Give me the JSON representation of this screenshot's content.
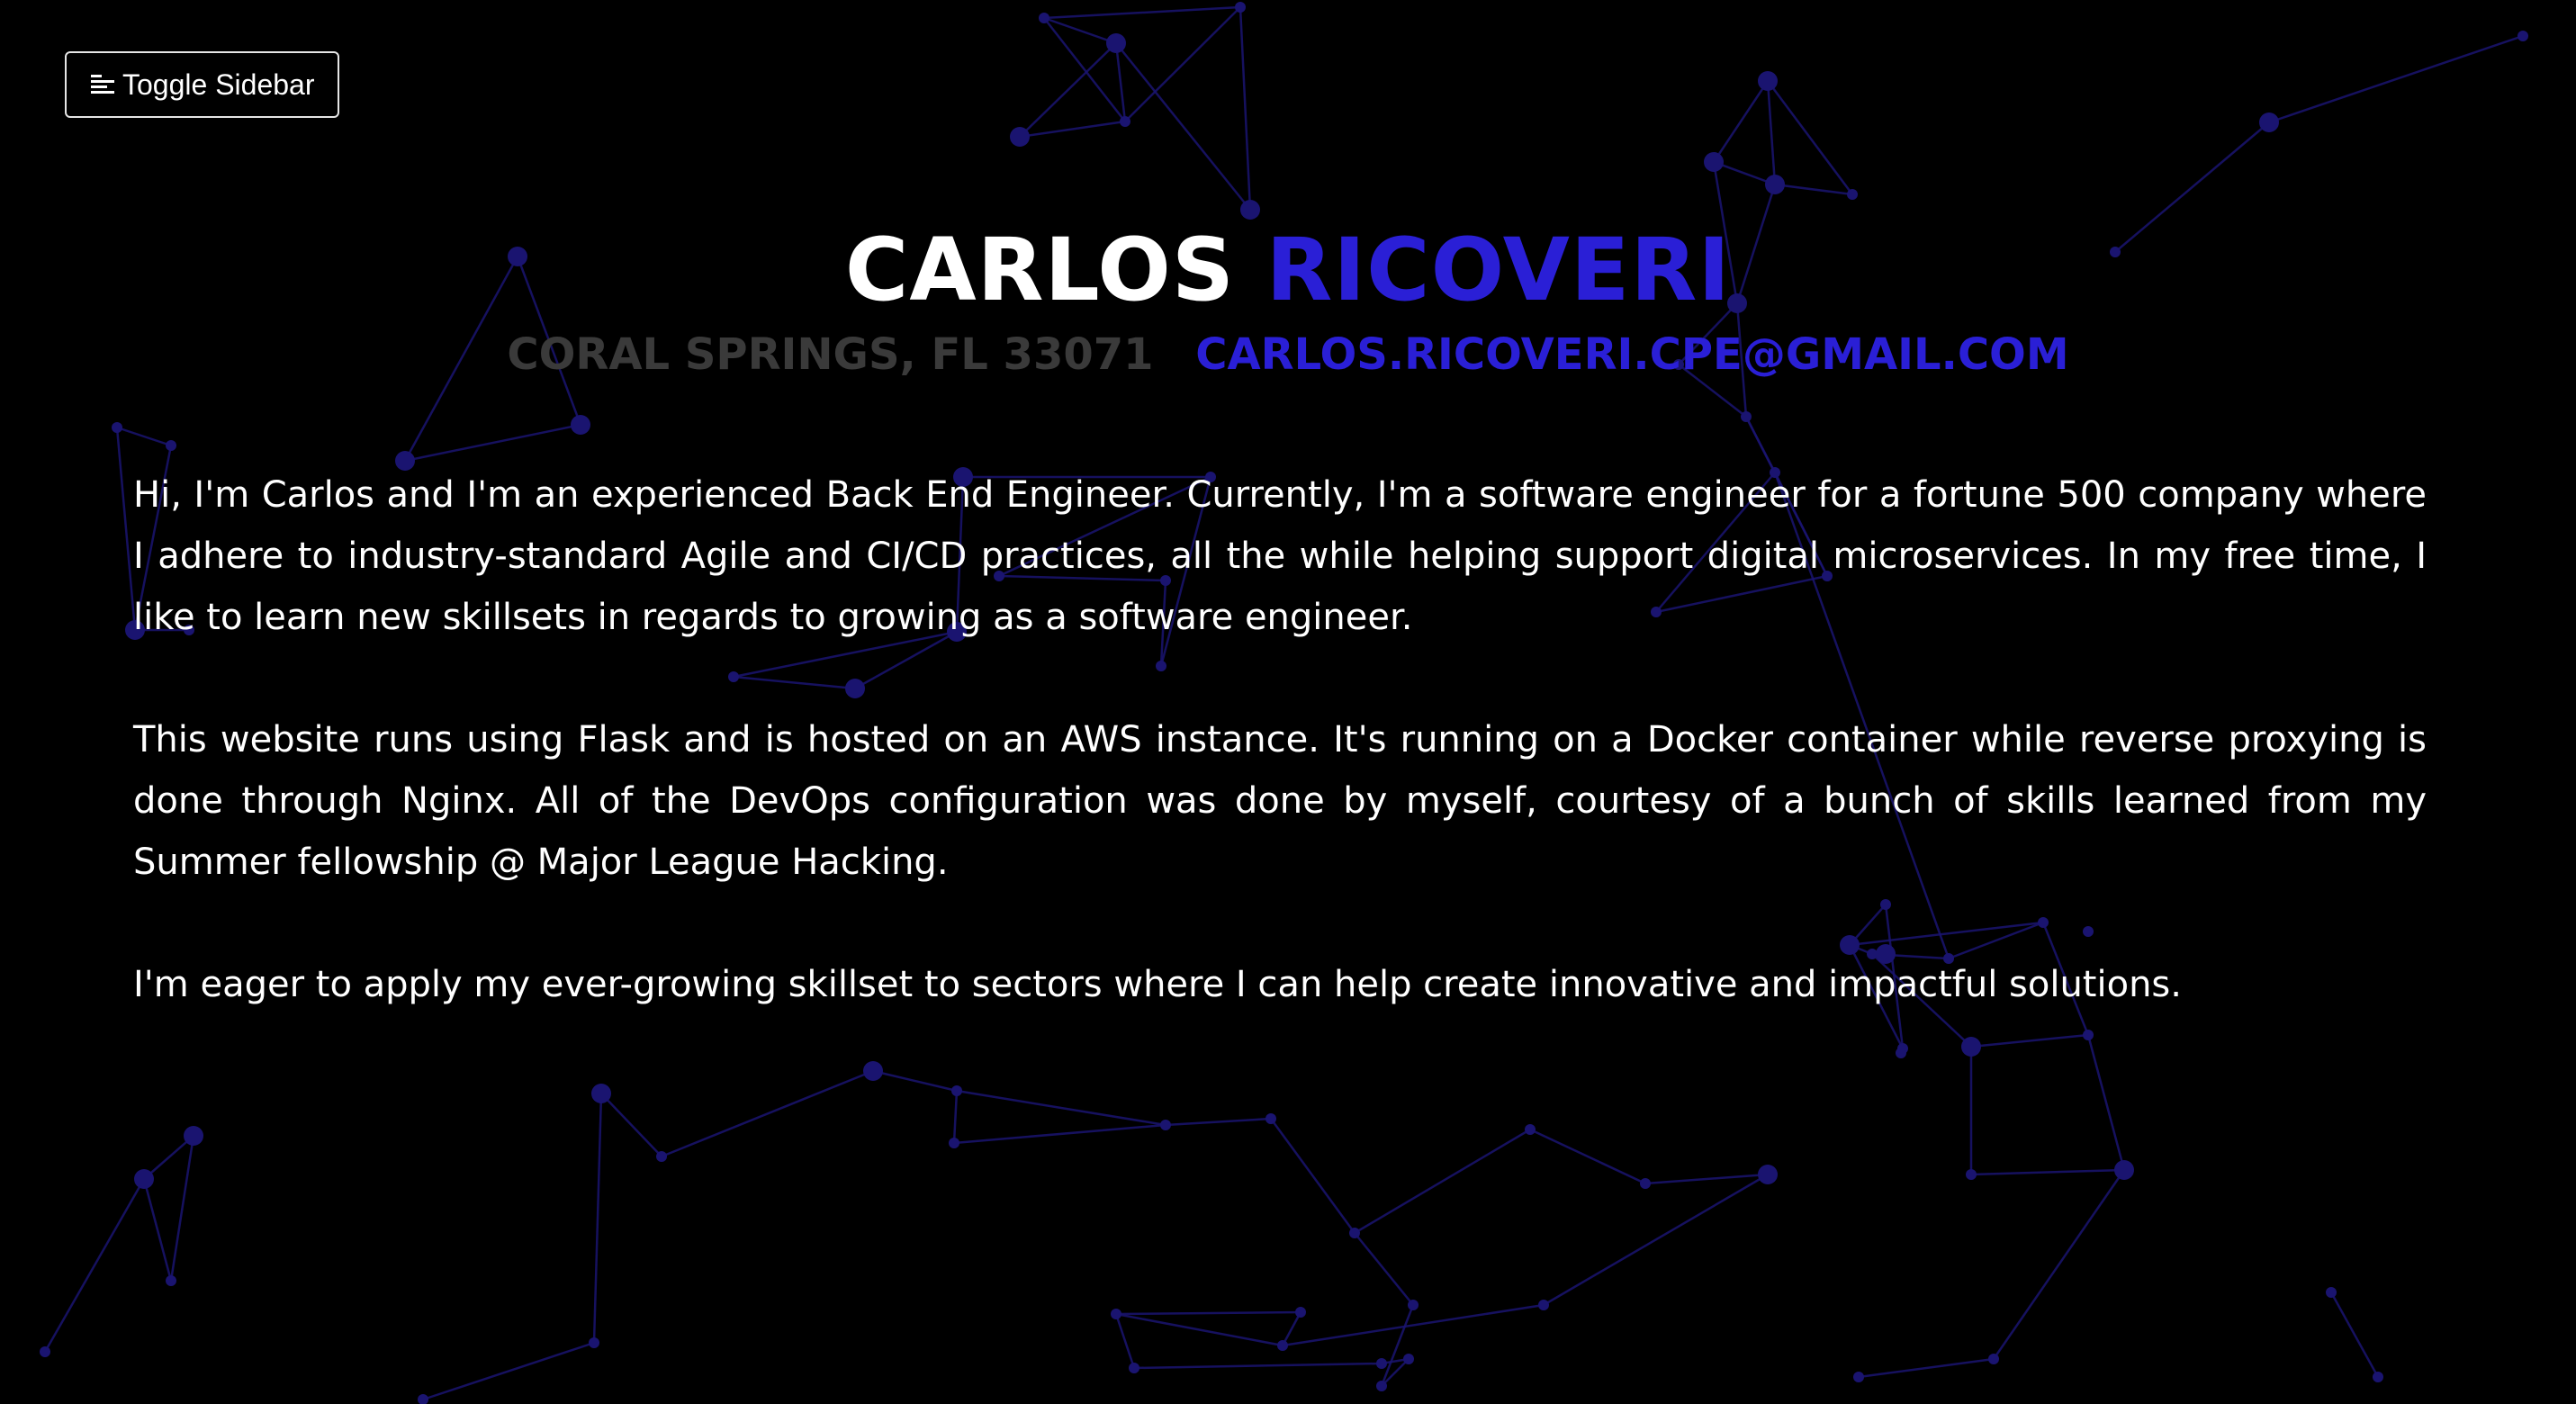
{
  "toolbar": {
    "toggle_label": "Toggle Sidebar",
    "toggle_icon": "menu-lines-icon"
  },
  "header": {
    "first_name": "CARLOS",
    "last_name": "RICOVERI",
    "location": "CORAL SPRINGS, FL 33071",
    "email": "CARLOS.RICOVERI.CPE@GMAIL.COM"
  },
  "bio": {
    "paragraphs": [
      "Hi, I'm Carlos and I'm an experienced Back End Engineer. Currently, I'm a software engineer for a fortune 500 company where I adhere to industry-standard Agile and CI/CD practices, all the while helping support digital microservices. In my free time, I like to learn new skillsets in regards to growing as a software engineer.",
      "This website runs using Flask and is hosted on an AWS instance. It's running on a Docker container while reverse proxying is done through Nginx. All of the DevOps configuration was done by myself, courtesy of a bunch of skills learned from my Summer fellowship @ Major League Hacking.",
      "I'm eager to apply my ever-growing skillset to sectors where I can help create innovative and impactful solutions."
    ]
  },
  "colors": {
    "background": "#000000",
    "accent": "#2a1fd6",
    "muted": "#3a3a3a",
    "network": "#1a1470"
  }
}
